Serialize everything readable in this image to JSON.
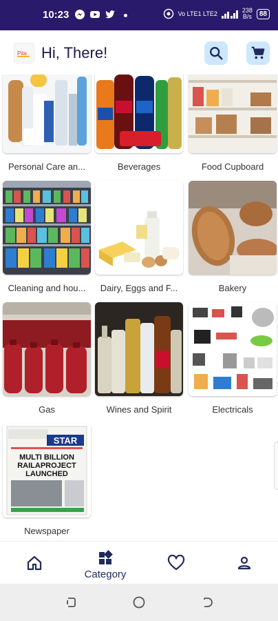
{
  "status_bar": {
    "time": "10:23",
    "network": "Vo LTE1 LTE2",
    "speed_value": "238",
    "speed_unit": "B/s",
    "battery": "88"
  },
  "header": {
    "greeting": "Hi, There!",
    "logo_text": "Pita"
  },
  "categories": [
    {
      "label": "Personal Care an..."
    },
    {
      "label": "Beverages"
    },
    {
      "label": "Food Cupboard"
    },
    {
      "label": "Cleaning and hou..."
    },
    {
      "label": "Dairy, Eggs and F..."
    },
    {
      "label": "Bakery"
    },
    {
      "label": "Gas"
    },
    {
      "label": "Wines and Spirit"
    },
    {
      "label": "Electricals"
    },
    {
      "label": "Newspaper"
    }
  ],
  "newspaper_thumb": {
    "masthead": "STAR",
    "headline_1": "MULTI BILLION",
    "headline_2": "RAILAPROJECT",
    "headline_3": "LAUNCHED"
  },
  "bottom_nav": {
    "active_label": "Category"
  },
  "colors": {
    "status_bar": "#2a1a6b",
    "header_button_bg": "#cde7ff",
    "nav_icon": "#1f2a5a"
  }
}
